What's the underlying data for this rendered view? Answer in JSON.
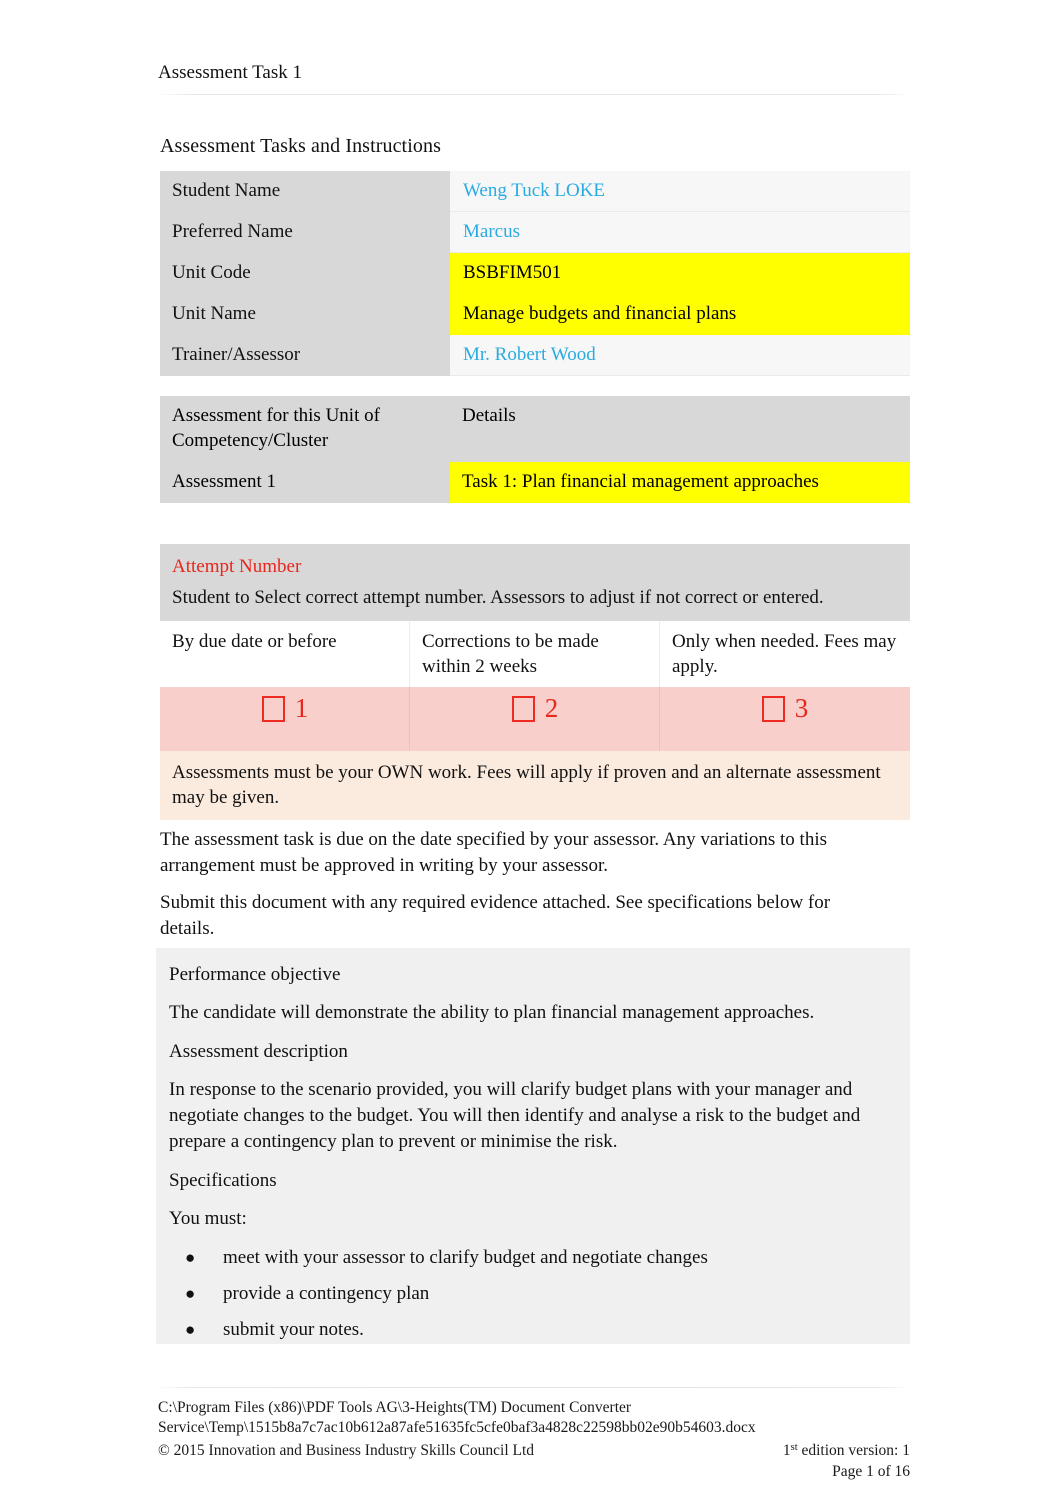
{
  "header": {
    "running_title": "Assessment Task 1"
  },
  "section": {
    "title": "Assessment Tasks and Instructions"
  },
  "details": {
    "rows": [
      {
        "label": "Student Name",
        "value": "Weng Tuck LOKE",
        "highlight": false
      },
      {
        "label": "Preferred Name",
        "value": "Marcus",
        "highlight": false
      },
      {
        "label": "Unit Code",
        "value": "BSBFIM501",
        "highlight": true
      },
      {
        "label": "Unit Name",
        "value": "Manage budgets and financial plans",
        "highlight": true
      },
      {
        "label": "Trainer/Assessor",
        "value": "Mr. Robert Wood",
        "highlight": false
      }
    ]
  },
  "assessment": {
    "header_label": "Assessment for this Unit of Competency/Cluster",
    "header_value": "Details",
    "row_label": "Assessment 1",
    "row_value": "Task 1: Plan financial management approaches"
  },
  "attempt": {
    "title": "Attempt Number",
    "instruction": "Student to Select correct attempt number. Assessors to adjust if not correct or entered.",
    "columns": [
      {
        "description": "By due date or before",
        "number": "1"
      },
      {
        "description": "Corrections to be made within 2 weeks",
        "number": "2"
      },
      {
        "description": "Only when needed. Fees may apply.",
        "number": "3"
      }
    ],
    "note": "Assessments must be your OWN work. Fees will apply if proven and an alternate assessment may be given."
  },
  "body": {
    "due_paragraph": "The assessment task is due on the date specified by your assessor. Any variations to this arrangement must be approved in writing by your assessor.",
    "submit_paragraph": "Submit this document with any required evidence attached. See specifications below for details."
  },
  "spec": {
    "performance_heading": "Performance objective",
    "performance_text": "The candidate will demonstrate the ability to plan financial management approaches.",
    "description_heading": "Assessment description",
    "description_text": "In response to the scenario provided, you will clarify budget plans with your manager and negotiate changes to the budget. You will then identify and analyse a risk to the budget and prepare a contingency plan to prevent or minimise the risk.",
    "specifications_heading": "Specifications",
    "you_must": "You must:",
    "items": [
      "meet with your assessor to clarify budget and negotiate changes",
      "provide a contingency plan",
      "submit your notes."
    ]
  },
  "footer": {
    "converter_line1": "C:\\Program Files (x86)\\PDF Tools AG\\3-Heights(TM) Document Converter",
    "converter_line2": "Service\\Temp\\1515b8a7c7ac10b612a87afe51635fc5cfe0baf3a4828c22598bb02e90b54603.docx",
    "copyright": "© 2015 Innovation and Business Industry Skills Council Ltd",
    "edition_prefix": "1",
    "edition_sup": "st",
    "edition_suffix": " edition version: 1",
    "page_label": "Page 1 of 16"
  },
  "colors": {
    "field_blue": "#29abe2",
    "highlight_yellow": "#ffff00",
    "attempt_red": "#e8261c",
    "label_gray": "#d8d8d8",
    "attempt_pink": "#f8cfcb",
    "note_peach": "#fbeade",
    "spec_gray": "#f0f0f0"
  }
}
